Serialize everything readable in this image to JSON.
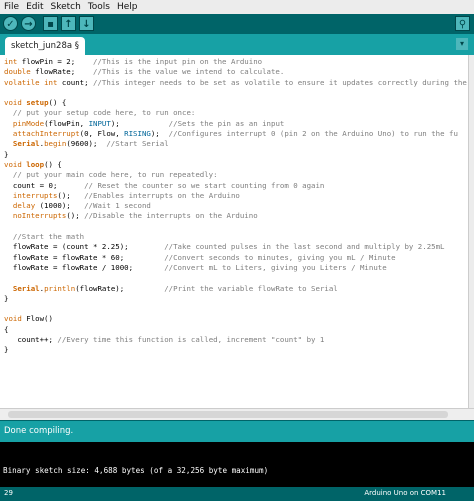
{
  "menu": [
    "File",
    "Edit",
    "Sketch",
    "Tools",
    "Help"
  ],
  "toolbar": {
    "buttons": [
      {
        "name": "verify-button",
        "glyph": "✓"
      },
      {
        "name": "upload-button",
        "glyph": "→"
      },
      {
        "name": "new-button",
        "glyph": "▪"
      },
      {
        "name": "open-button",
        "glyph": "↑"
      },
      {
        "name": "save-button",
        "glyph": "↓"
      },
      {
        "name": "serial-monitor-button",
        "glyph": "⚲"
      }
    ]
  },
  "tab": {
    "label": "sketch_jun28a §"
  },
  "tab_menu": {
    "glyph": "▾"
  },
  "editor": {
    "lines": [
      "int flowPin = 2;    //This is the input pin on the Arduino",
      "double flowRate;    //This is the value we intend to calculate.",
      "volatile int count; //This integer needs to be set as volatile to ensure it updates correctly during the",
      "",
      "void setup() {",
      "  // put your setup code here, to run once:",
      "  pinMode(flowPin, INPUT);           //Sets the pin as an input",
      "  attachInterrupt(0, Flow, RISING);  //Configures interrupt 0 (pin 2 on the Arduino Uno) to run the fu",
      "  Serial.begin(9600);  //Start Serial",
      "}",
      "void loop() {",
      "  // put your main code here, to run repeatedly:",
      "  count = 0;      // Reset the counter so we start counting from 0 again",
      "  interrupts();   //Enables interrupts on the Arduino",
      "  delay (1000);   //Wait 1 second",
      "  noInterrupts(); //Disable the interrupts on the Arduino",
      "",
      "  //Start the math",
      "  flowRate = (count * 2.25);        //Take counted pulses in the last second and multiply by 2.25mL",
      "  flowRate = flowRate * 60;         //Convert seconds to minutes, giving you mL / Minute",
      "  flowRate = flowRate / 1000;       //Convert mL to Liters, giving you Liters / Minute",
      "",
      "  Serial.println(flowRate);         //Print the variable flowRate to Serial",
      "}",
      "",
      "void Flow()",
      "{",
      "   count++; //Every time this function is called, increment \"count\" by 1",
      "}"
    ]
  },
  "status": {
    "text": "Done compiling."
  },
  "console": {
    "text": "Binary sketch size: 4,688 bytes (of a 32,256 byte maximum)"
  },
  "footer": {
    "line_number": "29",
    "board": "Arduino Uno on COM11"
  },
  "colors": {
    "toolbar_bg": "#006468",
    "tabs_bg": "#17a1a5",
    "keyword": "#cc6600",
    "comment": "#7e7e7e",
    "constant": "#006699"
  }
}
